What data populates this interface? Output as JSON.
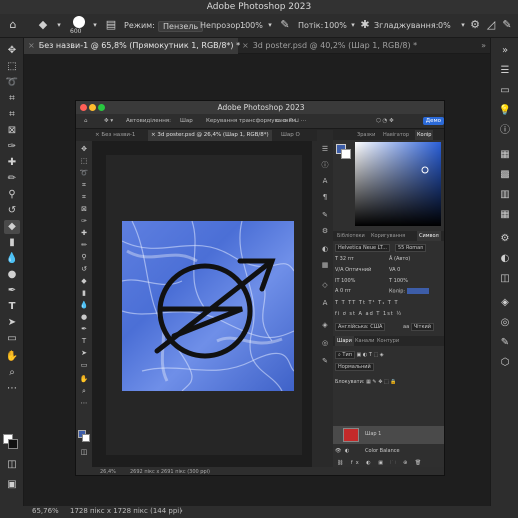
{
  "app": {
    "title": "Adobe Photoshop 2023"
  },
  "options": {
    "mode_label": "Режим:",
    "mode_value": "Пензель",
    "opacity_label": "Непрозор.:",
    "opacity_value": "100%",
    "flow_label": "Потік:",
    "flow_value": "100%",
    "smoothing_label": "Згладжування:",
    "smoothing_value": "0%",
    "brush_size": "600"
  },
  "tabs": [
    {
      "label": "Без назви-1 @ 65,8% (Прямокутник 1, RGB/8*) *"
    },
    {
      "label": "3d poster.psd @ 40,2% (Шар 1, RGB/8) *"
    }
  ],
  "status": {
    "zoom": "65,76%",
    "size": "1728 пікс х 1728 пікс (144 ppi)"
  },
  "inner": {
    "title": "Adobe Photoshop 2023",
    "options": {
      "autoselect": "Автовиділення:",
      "layer": "Шар",
      "transform": "Керування трансформуванням",
      "share": "Демо"
    },
    "tabs": [
      {
        "label": "Без назви-1"
      },
      {
        "label": "3d poster.psd @ 26,4% (Шар 1, RGB/8*)"
      },
      {
        "label": "Шар О"
      }
    ],
    "status": {
      "zoom": "26,4%",
      "size": "2692 пікс х 2691 пікс (300 ppi)"
    },
    "panels": {
      "color_tabs": [
        "Зразки",
        "Навігатор",
        "Колір"
      ],
      "color_active": 2,
      "char_tabs": [
        "Бібліотеки",
        "Коригування",
        "Символ"
      ],
      "char_active": 2,
      "font_family": "Helvetica Neue LT...",
      "font_style": "55 Roman",
      "font_size": "32 пт",
      "leading": "(Авто)",
      "kerning": "Оптичний",
      "tracking": "0",
      "vscale": "100%",
      "hscale": "100%",
      "baseline": "0 пт",
      "color_label": "Колір:",
      "language": "Англійська: США",
      "aa": "Чіткий",
      "layer_tabs": [
        "Шари",
        "Канали",
        "Контури"
      ],
      "layer_active": 0,
      "kind": "Тип",
      "blend": "Нормальний",
      "lock_label": "Блокувати:",
      "layers": [
        {
          "name": "Шар 1"
        },
        {
          "name": "Color Balance"
        }
      ]
    }
  }
}
